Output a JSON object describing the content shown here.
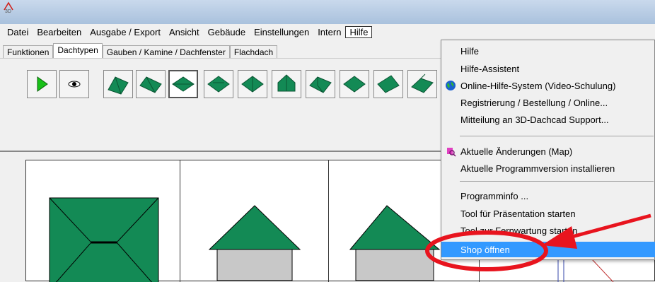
{
  "window": {
    "icon": "3d-dachcad-icon"
  },
  "menubar": {
    "items": [
      {
        "label": "Datei"
      },
      {
        "label": "Bearbeiten"
      },
      {
        "label": "Ausgabe / Export"
      },
      {
        "label": "Ansicht"
      },
      {
        "label": "Gebäude"
      },
      {
        "label": "Einstellungen"
      },
      {
        "label": "Intern"
      },
      {
        "label": "Hilfe"
      }
    ]
  },
  "tabs": [
    {
      "label": "Funktionen"
    },
    {
      "label": "Dachtypen"
    },
    {
      "label": "Gauben / Kamine / Dachfenster"
    },
    {
      "label": "Flachdach"
    }
  ],
  "toolbar": {
    "buttons": [
      "play-icon",
      "eye-icon",
      "gable-roof-icon",
      "gable-roof-2-icon",
      "hip-roof-icon",
      "hip-roof-2-icon",
      "hip-roof-3-icon",
      "tent-roof-icon",
      "l-roof-icon",
      "l-roof-2-icon",
      "roof-icon",
      "roof-2-icon"
    ]
  },
  "help_menu": {
    "items": [
      {
        "label": "Hilfe"
      },
      {
        "label": "Hilfe-Assistent"
      },
      {
        "label": "Online-Hilfe-System (Video-Schulung)",
        "icon": "globe-icon"
      },
      {
        "label": "Registrierung / Bestellung / Online..."
      },
      {
        "label": "Mitteilung an 3D-Dachcad Support..."
      },
      {
        "label": "Aktuelle Änderungen (Map)",
        "icon": "map-icon"
      },
      {
        "label": "Aktuelle Programmversion installieren"
      },
      {
        "label": "Programminfo ..."
      },
      {
        "label": "Tool für Präsentation starten"
      },
      {
        "label": "Tool zur Fernwartung starten"
      },
      {
        "label": "Shop öffnen"
      }
    ]
  },
  "colors": {
    "roof_green": "#138a55",
    "highlight": "#3399ff",
    "annotation_red": "#e8141e"
  }
}
